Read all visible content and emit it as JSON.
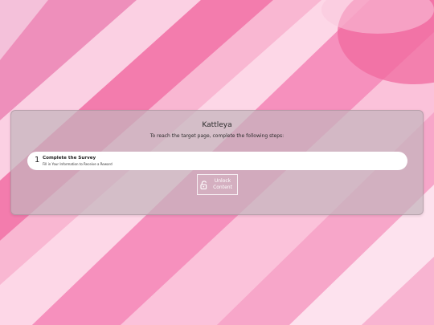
{
  "locker": {
    "title": "Kattleya",
    "subtitle": "To reach the target page, complete the following steps:",
    "steps": [
      {
        "number": "1",
        "title": "Complete the Survey",
        "description": "Fill in Your Information to Receive a Reward"
      }
    ],
    "unlock_button": {
      "line1": "Unlock",
      "line2": "Content",
      "icon": "lock-icon"
    }
  },
  "colors": {
    "background_base": "#f7a9c8",
    "card": "#c4b4bc",
    "step_background": "#ffffff",
    "unlock_text": "#ffffff"
  }
}
